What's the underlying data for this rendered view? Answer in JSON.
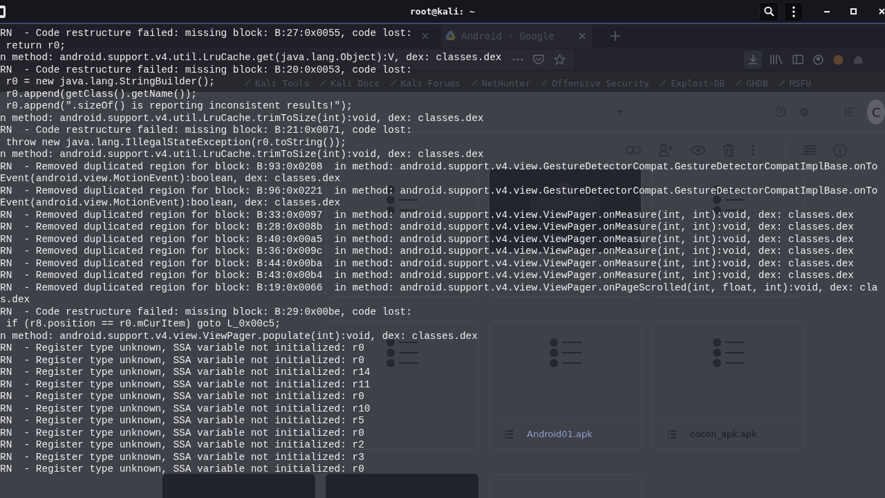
{
  "browser": {
    "tab": {
      "title": "Android - Google"
    },
    "bookmarks": [
      "Kali Tools",
      "Kali Docs",
      "Kali Forums",
      "NetHunter",
      "Offensive Security",
      "Exploit-DB",
      "GHDB",
      "MSFU"
    ],
    "avatar": "C",
    "files": [
      {
        "kind": "none"
      },
      {
        "kind": "doc"
      },
      {
        "kind": "picture"
      },
      {
        "kind": "doc"
      },
      {
        "kind": "none"
      },
      {
        "kind": "doc"
      },
      {
        "kind": "doc",
        "name": "Android01.apk"
      },
      {
        "kind": "doc",
        "name": "cocon_apk.apk"
      },
      {
        "kind": "dark"
      },
      {
        "kind": "dark"
      },
      {
        "kind": "empty"
      },
      {
        "kind": "none"
      }
    ]
  },
  "terminal": {
    "title": "root@kali: ~",
    "lines": [
      "RN  - Code restructure failed: missing block: B:27:0x0055, code lost:",
      " return r0;",
      "n method: android.support.v4.util.LruCache.get(java.lang.Object):V, dex: classes.dex",
      "RN  - Code restructure failed: missing block: B:20:0x0053, code lost:",
      " r0 = new java.lang.StringBuilder();",
      " r0.append(getClass().getName());",
      " r0.append(\".sizeOf() is reporting inconsistent results!\");",
      "n method: android.support.v4.util.LruCache.trimToSize(int):void, dex: classes.dex",
      "RN  - Code restructure failed: missing block: B:21:0x0071, code lost:",
      " throw new java.lang.IllegalStateException(r0.toString());",
      "n method: android.support.v4.util.LruCache.trimToSize(int):void, dex: classes.dex",
      "RN  - Removed duplicated region for block: B:93:0x0208  in method: android.support.v4.view.GestureDetectorCompat.GestureDetectorCompatImplBase.onTo",
      "Event(android.view.MotionEvent):boolean, dex: classes.dex",
      "RN  - Removed duplicated region for block: B:96:0x0221  in method: android.support.v4.view.GestureDetectorCompat.GestureDetectorCompatImplBase.onTo",
      "Event(android.view.MotionEvent):boolean, dex: classes.dex",
      "RN  - Removed duplicated region for block: B:33:0x0097  in method: android.support.v4.view.ViewPager.onMeasure(int, int):void, dex: classes.dex",
      "RN  - Removed duplicated region for block: B:28:0x008b  in method: android.support.v4.view.ViewPager.onMeasure(int, int):void, dex: classes.dex",
      "RN  - Removed duplicated region for block: B:40:0x00a5  in method: android.support.v4.view.ViewPager.onMeasure(int, int):void, dex: classes.dex",
      "RN  - Removed duplicated region for block: B:36:0x009c  in method: android.support.v4.view.ViewPager.onMeasure(int, int):void, dex: classes.dex",
      "RN  - Removed duplicated region for block: B:44:0x00ba  in method: android.support.v4.view.ViewPager.onMeasure(int, int):void, dex: classes.dex",
      "RN  - Removed duplicated region for block: B:43:0x00b4  in method: android.support.v4.view.ViewPager.onMeasure(int, int):void, dex: classes.dex",
      "RN  - Removed duplicated region for block: B:19:0x0066  in method: android.support.v4.view.ViewPager.onPageScrolled(int, float, int):void, dex: cla",
      "s.dex",
      "RN  - Code restructure failed: missing block: B:29:0x00be, code lost:",
      " if (r8.position == r0.mCurItem) goto L_0x00c5;",
      "n method: android.support.v4.view.ViewPager.populate(int):void, dex: classes.dex",
      "RN  - Register type unknown, SSA variable not initialized: r0",
      "RN  - Register type unknown, SSA variable not initialized: r0",
      "RN  - Register type unknown, SSA variable not initialized: r14",
      "RN  - Register type unknown, SSA variable not initialized: r11",
      "RN  - Register type unknown, SSA variable not initialized: r0",
      "RN  - Register type unknown, SSA variable not initialized: r10",
      "RN  - Register type unknown, SSA variable not initialized: r5",
      "RN  - Register type unknown, SSA variable not initialized: r0",
      "RN  - Register type unknown, SSA variable not initialized: r2",
      "RN  - Register type unknown, SSA variable not initialized: r3",
      "RN  - Register type unknown, SSA variable not initialized: r0"
    ]
  }
}
